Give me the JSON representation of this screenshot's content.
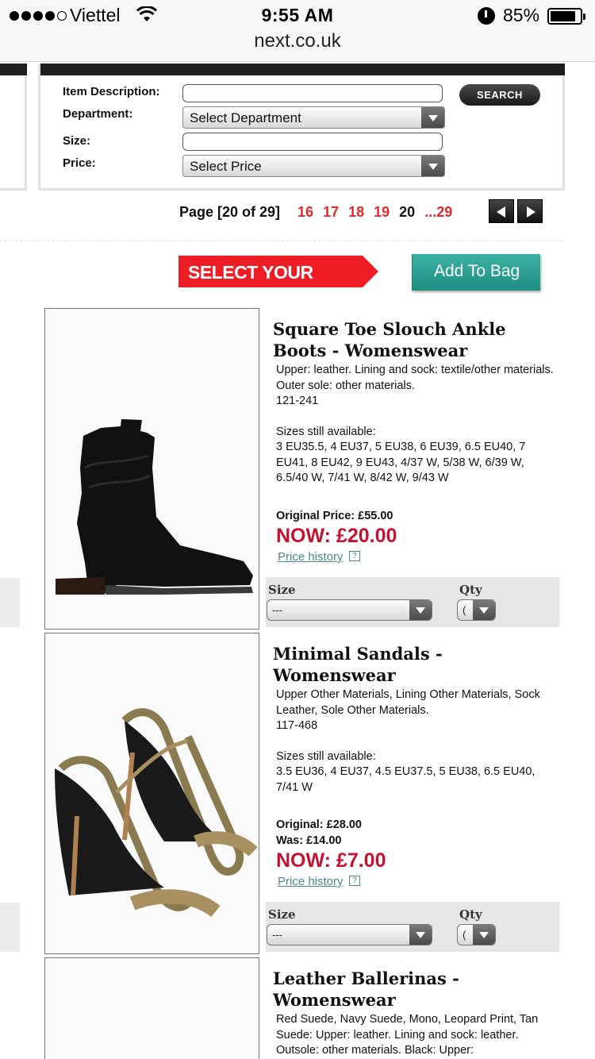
{
  "status_bar": {
    "carrier": "Viettel",
    "time": "9:55 AM",
    "battery_percent": "85%",
    "battery_level": 0.85,
    "signal_bars_filled": 4,
    "signal_bars_total": 5
  },
  "browser": {
    "url": "next.co.uk"
  },
  "search": {
    "item_description_label": "Item Description:",
    "item_description_value": "",
    "department_label": "Department:",
    "department_selected": "Select Department",
    "size_label": "Size:",
    "size_value": "",
    "price_label": "Price:",
    "price_selected": "Select Price",
    "search_button": "SEARCH"
  },
  "pagination": {
    "label": "Page [20 of 29]",
    "pages": [
      "16",
      "17",
      "18",
      "19",
      "20"
    ],
    "current": "20",
    "last": "...29"
  },
  "actions": {
    "select_items_banner": "SELECT YOUR ITEMS &",
    "add_to_bag": "Add To Bag"
  },
  "products": [
    {
      "title": "Square Toe Slouch Ankle Boots - Womenswear",
      "description": "Upper: leather. Lining and sock: textile/other materials. Outer sole: other materials.",
      "code": "121-241",
      "sizes_heading": "Sizes still available:",
      "sizes": "3 EU35.5, 4 EU37, 5 EU38, 6 EU39, 6.5 EU40, 7 EU41, 8 EU42, 9 EU43, 4/37 W, 5/38 W, 6/39 W, 6.5/40 W, 7/41 W, 8/42 W, 9/43 W",
      "original_price": "Original Price: £55.00",
      "now_price": "NOW: £20.00",
      "price_history": "Price history",
      "size_label": "Size",
      "size_value": "---",
      "qty_label": "Qty",
      "qty_value": "("
    },
    {
      "title": "Minimal Sandals - Womenswear",
      "description": "Upper Other Materials, Lining Other Materials, Sock Leather, Sole Other Materials.",
      "code": "117-468",
      "sizes_heading": "Sizes still available:",
      "sizes": "3.5 EU36, 4 EU37, 4.5 EU37.5, 5 EU38, 6.5 EU40, 7/41 W",
      "original_price": "Original: £28.00",
      "was_price": "Was: £14.00",
      "now_price": "NOW: £7.00",
      "price_history": "Price history",
      "size_label": "Size",
      "size_value": "---",
      "qty_label": "Qty",
      "qty_value": "("
    },
    {
      "title": "Leather Ballerinas - Womenswear",
      "description": "Red Suede, Navy Suede, Mono, Leopard Print, Tan Suede: Upper: leather. Lining and sock: leather. Outsole: other materials. Black: Upper:"
    }
  ],
  "colors": {
    "price_red": "#c41230",
    "page_link_red": "#e4282b",
    "banner_red": "#ee1c24",
    "add_to_bag_teal": "#2aa092",
    "link_teal": "#4a8a8c"
  }
}
